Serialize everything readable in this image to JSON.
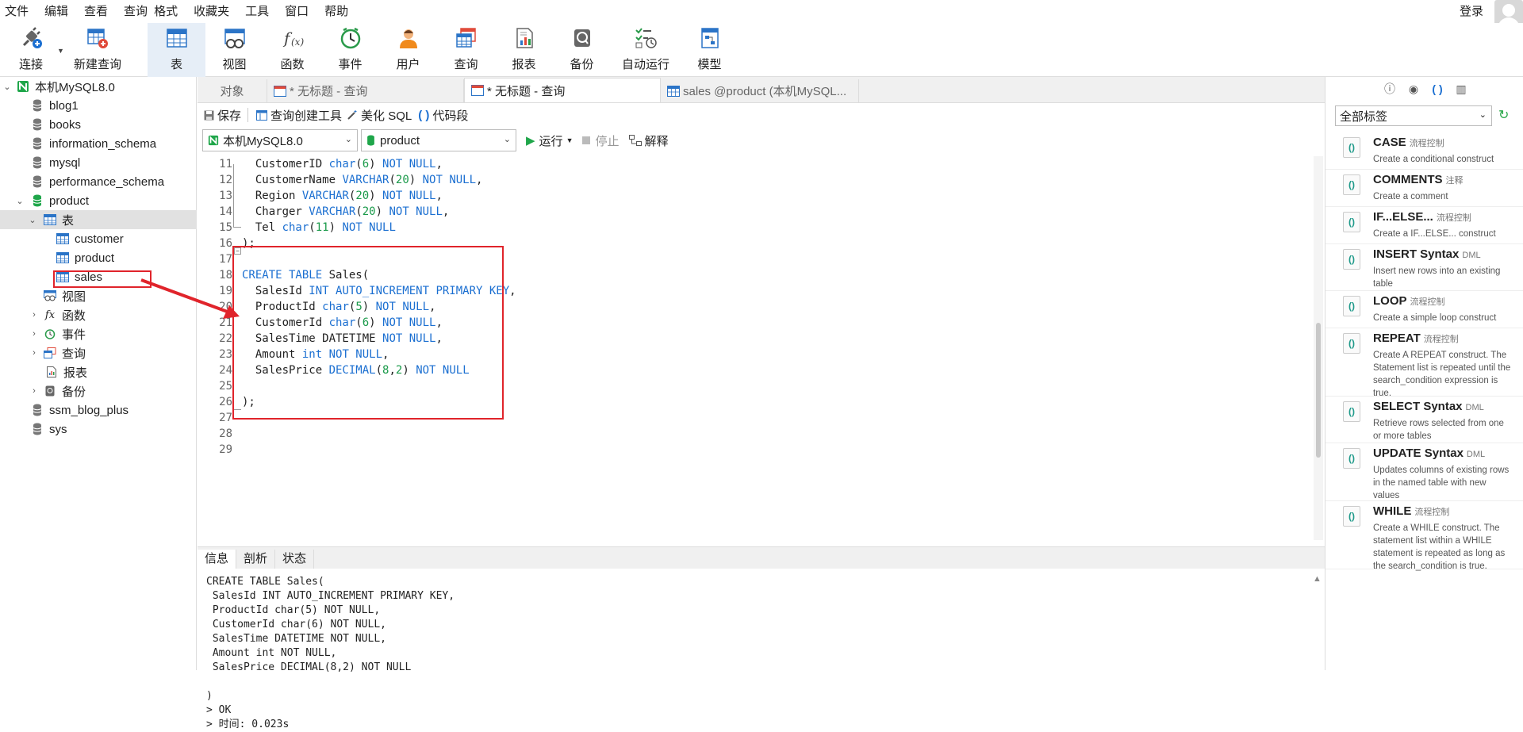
{
  "menu": [
    "文件",
    "编辑",
    "查看",
    "查询",
    "格式",
    "收藏夹",
    "工具",
    "窗口",
    "帮助"
  ],
  "login": "登录",
  "toolbar": [
    {
      "label": "连接",
      "icon": "plug-icon"
    },
    {
      "label": "新建查询",
      "icon": "new-query-icon"
    },
    {
      "label": "表",
      "icon": "table-icon"
    },
    {
      "label": "视图",
      "icon": "view-icon"
    },
    {
      "label": "函数",
      "icon": "function-icon"
    },
    {
      "label": "事件",
      "icon": "clock-icon"
    },
    {
      "label": "用户",
      "icon": "user-icon"
    },
    {
      "label": "查询",
      "icon": "query-icon"
    },
    {
      "label": "报表",
      "icon": "report-icon"
    },
    {
      "label": "备份",
      "icon": "backup-icon"
    },
    {
      "label": "自动运行",
      "icon": "auto-run-icon"
    },
    {
      "label": "模型",
      "icon": "model-icon"
    }
  ],
  "tree": {
    "connection": "本机MySQL8.0",
    "databases": [
      "blog1",
      "books",
      "information_schema",
      "mysql",
      "performance_schema",
      "product"
    ],
    "tables_group": "表",
    "tables": [
      "customer",
      "product",
      "sales"
    ],
    "groups": [
      "视图",
      "函数",
      "事件",
      "查询",
      "报表",
      "备份"
    ],
    "more_databases": [
      "ssm_blog_plus",
      "sys"
    ]
  },
  "tabs": [
    "对象",
    "* 无标题 - 查询",
    "* 无标题 - 查询",
    "sales @product (本机MySQL..."
  ],
  "editor_toolbar": {
    "save": "保存",
    "builder": "查询创建工具",
    "beautify": "美化 SQL",
    "snippet": "代码段"
  },
  "selectors": {
    "connection": "本机MySQL8.0",
    "database": "product",
    "run": "运行",
    "stop": "停止",
    "explain": "解释"
  },
  "code_lines": [
    {
      "n": "11",
      "t": [
        [
          "  CustomerID ",
          ""
        ],
        [
          "char",
          "kw"
        ],
        [
          "(",
          ""
        ],
        [
          "6",
          "num"
        ],
        [
          ") ",
          ""
        ],
        [
          "NOT NULL",
          "kw"
        ],
        [
          ",",
          ""
        ]
      ]
    },
    {
      "n": "12",
      "t": [
        [
          "  CustomerName ",
          ""
        ],
        [
          "VARCHAR",
          "kw"
        ],
        [
          "(",
          ""
        ],
        [
          "20",
          "num"
        ],
        [
          ") ",
          ""
        ],
        [
          "NOT NULL",
          "kw"
        ],
        [
          ",",
          ""
        ]
      ]
    },
    {
      "n": "13",
      "t": [
        [
          "  Region ",
          ""
        ],
        [
          "VARCHAR",
          "kw"
        ],
        [
          "(",
          ""
        ],
        [
          "20",
          "num"
        ],
        [
          ") ",
          ""
        ],
        [
          "NOT NULL",
          "kw"
        ],
        [
          ",",
          ""
        ]
      ]
    },
    {
      "n": "14",
      "t": [
        [
          "  Charger ",
          ""
        ],
        [
          "VARCHAR",
          "kw"
        ],
        [
          "(",
          ""
        ],
        [
          "20",
          "num"
        ],
        [
          ") ",
          ""
        ],
        [
          "NOT NULL",
          "kw"
        ],
        [
          ",",
          ""
        ]
      ]
    },
    {
      "n": "15",
      "t": [
        [
          "  Tel ",
          ""
        ],
        [
          "char",
          "kw"
        ],
        [
          "(",
          ""
        ],
        [
          "11",
          "num"
        ],
        [
          ") ",
          ""
        ],
        [
          "NOT NULL",
          "kw"
        ]
      ]
    },
    {
      "n": "16",
      "t": [
        [
          ");",
          ""
        ]
      ]
    },
    {
      "n": "17",
      "t": []
    },
    {
      "n": "18",
      "t": [
        [
          "CREATE TABLE",
          "kw"
        ],
        [
          " Sales(",
          ""
        ]
      ]
    },
    {
      "n": "19",
      "t": [
        [
          "  SalesId ",
          ""
        ],
        [
          "INT AUTO_INCREMENT PRIMARY KEY",
          "kw"
        ],
        [
          ",",
          ""
        ]
      ]
    },
    {
      "n": "20",
      "t": [
        [
          "  ProductId ",
          ""
        ],
        [
          "char",
          "kw"
        ],
        [
          "(",
          ""
        ],
        [
          "5",
          "num"
        ],
        [
          ") ",
          ""
        ],
        [
          "NOT NULL",
          "kw"
        ],
        [
          ",",
          ""
        ]
      ]
    },
    {
      "n": "21",
      "t": [
        [
          "  CustomerId ",
          ""
        ],
        [
          "char",
          "kw"
        ],
        [
          "(",
          ""
        ],
        [
          "6",
          "num"
        ],
        [
          ") ",
          ""
        ],
        [
          "NOT NULL",
          "kw"
        ],
        [
          ",",
          ""
        ]
      ]
    },
    {
      "n": "22",
      "t": [
        [
          "  SalesTime DATETIME ",
          ""
        ],
        [
          "NOT NULL",
          "kw"
        ],
        [
          ",",
          ""
        ]
      ]
    },
    {
      "n": "23",
      "t": [
        [
          "  Amount ",
          ""
        ],
        [
          "int",
          "kw"
        ],
        [
          " ",
          ""
        ],
        [
          "NOT NULL",
          "kw"
        ],
        [
          ",",
          ""
        ]
      ]
    },
    {
      "n": "24",
      "t": [
        [
          "  SalesPrice ",
          ""
        ],
        [
          "DECIMAL",
          "kw"
        ],
        [
          "(",
          ""
        ],
        [
          "8",
          "num"
        ],
        [
          ",",
          ""
        ],
        [
          "2",
          "num"
        ],
        [
          ") ",
          ""
        ],
        [
          "NOT NULL",
          "kw"
        ]
      ]
    },
    {
      "n": "25",
      "t": []
    },
    {
      "n": "26",
      "t": [
        [
          ");",
          ""
        ]
      ]
    },
    {
      "n": "27",
      "t": []
    },
    {
      "n": "28",
      "t": []
    },
    {
      "n": "29",
      "t": []
    }
  ],
  "bottom_tabs": [
    "信息",
    "剖析",
    "状态"
  ],
  "output": "CREATE TABLE Sales(\n SalesId INT AUTO_INCREMENT PRIMARY KEY,\n ProductId char(5) NOT NULL,\n CustomerId char(6) NOT NULL,\n SalesTime DATETIME NOT NULL,\n Amount int NOT NULL,\n SalesPrice DECIMAL(8,2) NOT NULL\n\n)\n> OK\n> 时间: 0.023s",
  "right_panel": {
    "filter": "全部标签",
    "snippets": [
      {
        "title": "CASE",
        "tag": "流程控制",
        "desc": "Create a conditional construct"
      },
      {
        "title": "COMMENTS",
        "tag": "注释",
        "desc": "Create a comment"
      },
      {
        "title": "IF...ELSE...",
        "tag": "流程控制",
        "desc": "Create a IF...ELSE... construct"
      },
      {
        "title": "INSERT Syntax",
        "tag": "DML",
        "desc": "Insert new rows into an existing table"
      },
      {
        "title": "LOOP",
        "tag": "流程控制",
        "desc": "Create a simple loop construct"
      },
      {
        "title": "REPEAT",
        "tag": "流程控制",
        "desc": "Create A REPEAT construct. The Statement list is repeated until the search_condition expression is true."
      },
      {
        "title": "SELECT Syntax",
        "tag": "DML",
        "desc": "Retrieve rows selected from one or more tables"
      },
      {
        "title": "UPDATE Syntax",
        "tag": "DML",
        "desc": "Updates columns of existing rows in the named table with new values"
      },
      {
        "title": "WHILE",
        "tag": "流程控制",
        "desc": "Create a WHILE construct. The statement list within a WHILE statement is repeated as long as the search_condition is true."
      }
    ]
  },
  "colors": {
    "keyword": "#1b6fd1",
    "number": "#1a9a4a",
    "highlight": "#e0242b",
    "db_icon": "#1fa64a"
  }
}
